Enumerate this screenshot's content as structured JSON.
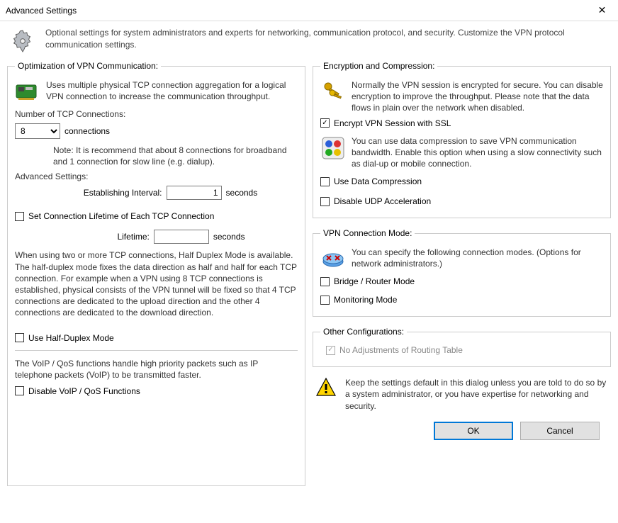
{
  "window": {
    "title": "Advanced Settings",
    "close": "✕"
  },
  "header": {
    "text": "Optional settings for system administrators and experts for networking, communication protocol, and security. Customize the VPN protocol communication settings."
  },
  "groups": {
    "optimization": {
      "legend": "Optimization of VPN Communication:",
      "intro": "Uses multiple physical TCP connection aggregation for a logical VPN connection to increase the communication throughput.",
      "numTcpLabel": "Number of TCP Connections:",
      "tcpValue": "8",
      "connectionsWord": "connections",
      "note": "Note: It is recommend that about 8 connections for broadband and 1 connection for slow line (e.g. dialup).",
      "advLabel": "Advanced Settings:",
      "estLabel": "Establishing Interval:",
      "estValue": "1",
      "secondsWord": "seconds",
      "setLifetimeCheck": "Set Connection Lifetime of Each TCP Connection",
      "lifetimeLabel": "Lifetime:",
      "lifetimeValue": "",
      "halfDuplexPara": "When using two or more TCP connections, Half Duplex Mode is available. The half-duplex mode fixes the data direction as half and half for each TCP connection. For example when a VPN using 8 TCP connections is established, physical consists of the VPN tunnel will be fixed so that 4 TCP connections are dedicated to the upload direction and the other 4 connections are dedicated to the download direction.",
      "halfDuplexCheck": "Use Half-Duplex Mode",
      "voipPara": "The VoIP / QoS functions handle high priority packets such as IP telephone packets (VoIP) to be transmitted faster.",
      "voipCheck": "Disable VoIP / QoS Functions"
    },
    "encryption": {
      "legend": "Encryption and Compression:",
      "sslPara": "Normally the VPN session is encrypted for secure. You can disable encryption to improve the throughput. Please note that the data flows in plain over the network when disabled.",
      "sslCheck": "Encrypt VPN Session with SSL",
      "compPara": "You can use data compression to save VPN communication bandwidth. Enable this option when using a slow connectivity such as dial-up or mobile connection.",
      "compCheck": "Use Data Compression",
      "udpCheck": "Disable UDP Acceleration"
    },
    "mode": {
      "legend": "VPN Connection Mode:",
      "para": "You can specify the following connection modes. (Options for network administrators.)",
      "bridgeCheck": "Bridge / Router Mode",
      "monitorCheck": "Monitoring Mode"
    },
    "other": {
      "legend": "Other Configurations:",
      "routingCheck": "No Adjustments of Routing Table"
    },
    "warning": {
      "text": "Keep the settings default in this dialog unless you are told to do so by a system administrator, or you have expertise for networking and security."
    }
  },
  "buttons": {
    "ok": "OK",
    "cancel": "Cancel"
  }
}
